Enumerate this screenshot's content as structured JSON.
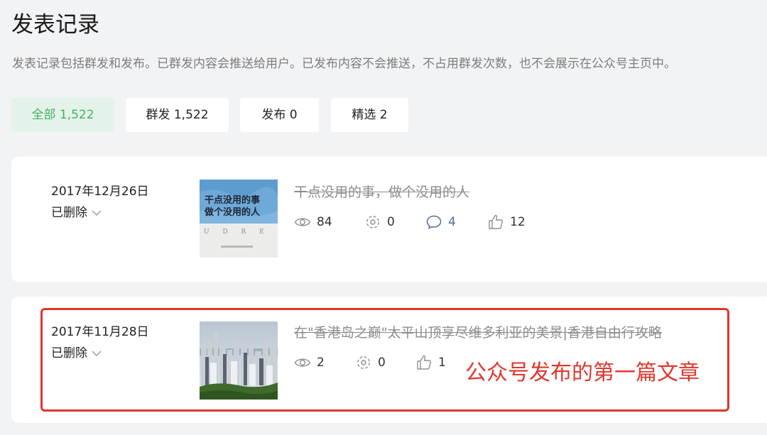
{
  "page": {
    "title": "发表记录",
    "description": "发表记录包括群发和发布。已群发内容会推送给用户。已发布内容不会推送，不占用群发次数，也不会展示在公众号主页中。"
  },
  "filters": [
    {
      "label": "全部 1,522",
      "active": true
    },
    {
      "label": "群发 1,522",
      "active": false
    },
    {
      "label": "发布 0",
      "active": false
    },
    {
      "label": "精选 2",
      "active": false
    }
  ],
  "records": [
    {
      "date": "2017年12月26日",
      "status": "已删除",
      "title": "干点没用的事，做个没用的人",
      "thumb_text": [
        "干点没用的事",
        "做个没用的人"
      ],
      "thumb_letters": "U D R E",
      "stats": {
        "views": "84",
        "shares": "0",
        "comments": "4",
        "likes": "12"
      }
    },
    {
      "date": "2017年11月28日",
      "status": "已删除",
      "title": "在\"香港岛之巅\"太平山顶享尽维多利亚的美景|香港自由行攻略",
      "stats": {
        "views": "2",
        "shares": "0",
        "likes": "1"
      }
    }
  ],
  "annotation": {
    "text": "公众号发布的第一篇文章",
    "color": "#e0372d"
  },
  "colors": {
    "accent_green": "#46b063",
    "active_tab_bg": "#e4f3e9",
    "comment_blue": "#576b95",
    "background": "#f2f3f5"
  },
  "icons": [
    "eye-icon",
    "share-icon",
    "comment-icon",
    "thumbs-up-icon",
    "chevron-down-icon"
  ]
}
